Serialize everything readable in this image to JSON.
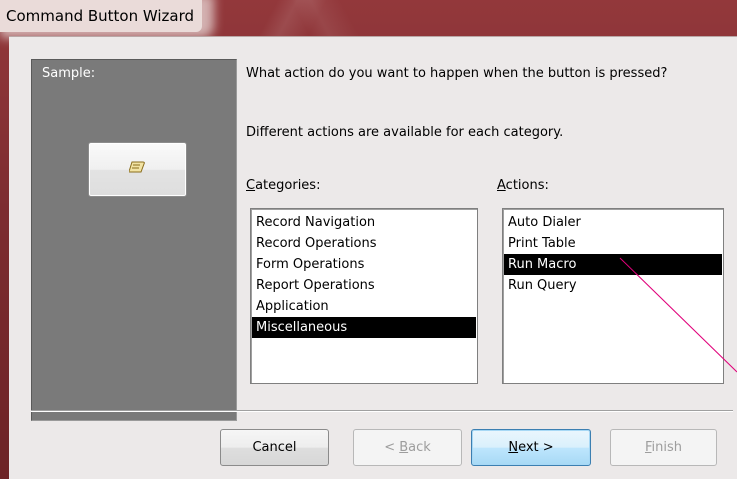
{
  "window": {
    "title": "Command Button Wizard"
  },
  "sample": {
    "label": "Sample:",
    "button_icon": "macro-scroll-icon"
  },
  "prompt": {
    "question": "What action do you want to happen when the button is pressed?",
    "hint": "Different actions are available for each category."
  },
  "categories": {
    "label_mnemonic": "C",
    "label_rest": "ategories:",
    "items": [
      {
        "label": "Record Navigation",
        "selected": false
      },
      {
        "label": "Record Operations",
        "selected": false
      },
      {
        "label": "Form Operations",
        "selected": false
      },
      {
        "label": "Report Operations",
        "selected": false
      },
      {
        "label": "Application",
        "selected": false
      },
      {
        "label": "Miscellaneous",
        "selected": true
      }
    ]
  },
  "actions": {
    "label_mnemonic": "A",
    "label_rest": "ctions:",
    "items": [
      {
        "label": "Auto Dialer",
        "selected": false
      },
      {
        "label": "Print Table",
        "selected": false
      },
      {
        "label": "Run Macro",
        "selected": true
      },
      {
        "label": "Run Query",
        "selected": false
      }
    ]
  },
  "buttons": {
    "cancel": "Cancel",
    "back_prefix": "< ",
    "back_mnemonic": "B",
    "back_rest": "ack",
    "next_mnemonic": "N",
    "next_rest": "ext >",
    "finish_mnemonic": "F",
    "finish_rest": "inish"
  },
  "colors": {
    "frame": "#7a2a2e",
    "selection": "#000000",
    "annotation_line": "#e0007a"
  }
}
